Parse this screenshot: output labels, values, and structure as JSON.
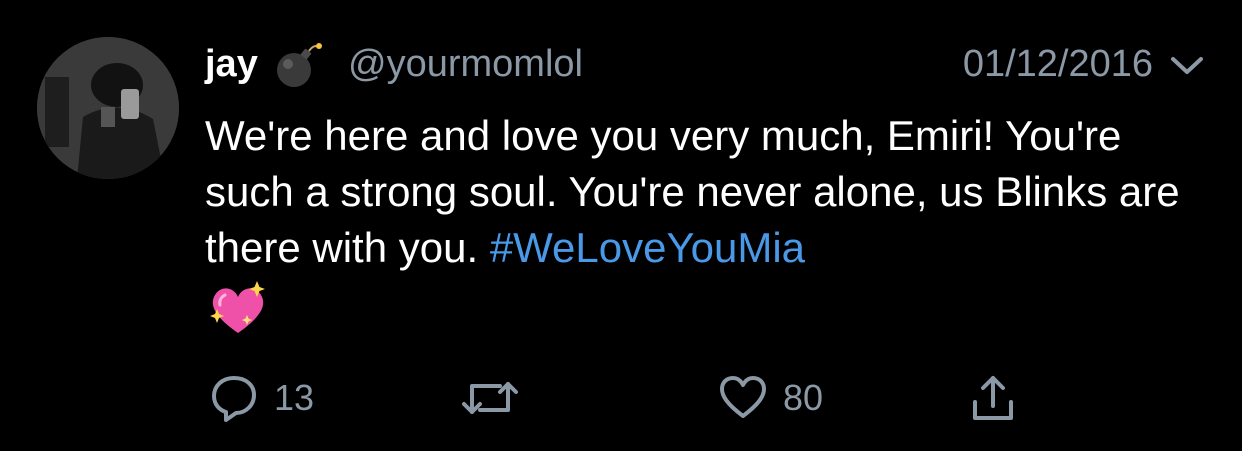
{
  "tweet": {
    "display_name": "jay",
    "name_emoji": "bomb-emoji",
    "handle": "@yourmomlol",
    "date": "01/12/2016",
    "text_main": "We're here and love you very much, Emiri! You're such a strong soul. You're never alone, us Blinks are there with you. ",
    "hashtag": "#WeLoveYouMia",
    "body_emoji": "sparkling-heart-emoji"
  },
  "actions": {
    "reply_count": "13",
    "like_count": "80",
    "reply_icon": "reply-icon",
    "retweet_icon": "retweet-icon",
    "like_icon": "heart-icon",
    "share_icon": "share-icon"
  },
  "colors": {
    "background": "#000000",
    "text": "#ffffff",
    "secondary": "#8b98a5",
    "link": "#4a99e9"
  }
}
